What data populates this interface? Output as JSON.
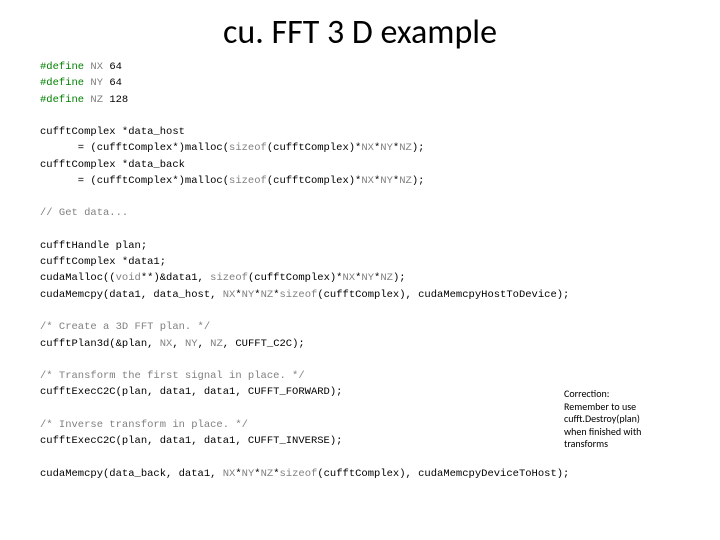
{
  "title": "cu. FFT 3 D example",
  "code": {
    "l1": "#define NX 64",
    "l2": "#define NY 64",
    "l3": "#define NZ 128",
    "l4": "",
    "l5": "cufftComplex *data_host",
    "l6": "      = (cufftComplex*)malloc(sizeof(cufftComplex)*NX*NY*NZ);",
    "l7": "cufftComplex *data_back",
    "l8": "      = (cufftComplex*)malloc(sizeof(cufftComplex)*NX*NY*NZ);",
    "l9": "",
    "l10": "// Get data...",
    "l11": "",
    "l12": "cufftHandle plan;",
    "l13": "cufftComplex *data1;",
    "l14": "cudaMalloc((void**)&data1, sizeof(cufftComplex)*NX*NY*NZ);",
    "l15": "cudaMemcpy(data1, data_host, NX*NY*NZ*sizeof(cufftComplex), cudaMemcpyHostToDevice);",
    "l16": "",
    "l17": "/* Create a 3D FFT plan. */",
    "l18": "cufftPlan3d(&plan, NX, NY, NZ, CUFFT_C2C);",
    "l19": "",
    "l20": "/* Transform the first signal in place. */",
    "l21": "cufftExecC2C(plan, data1, data1, CUFFT_FORWARD);",
    "l22": "",
    "l23": "/* Inverse transform in place. */",
    "l24": "cufftExecC2C(plan, data1, data1, CUFFT_INVERSE);",
    "l25": "",
    "l26": "cudaMemcpy(data_back, data1, NX*NY*NZ*sizeof(cufftComplex), cudaMemcpyDeviceToHost);"
  },
  "note": {
    "line1": "Correction:",
    "line2": "Remember to use",
    "line3": "cufft.Destroy(plan)",
    "line4": "when finished with",
    "line5": "transforms"
  }
}
